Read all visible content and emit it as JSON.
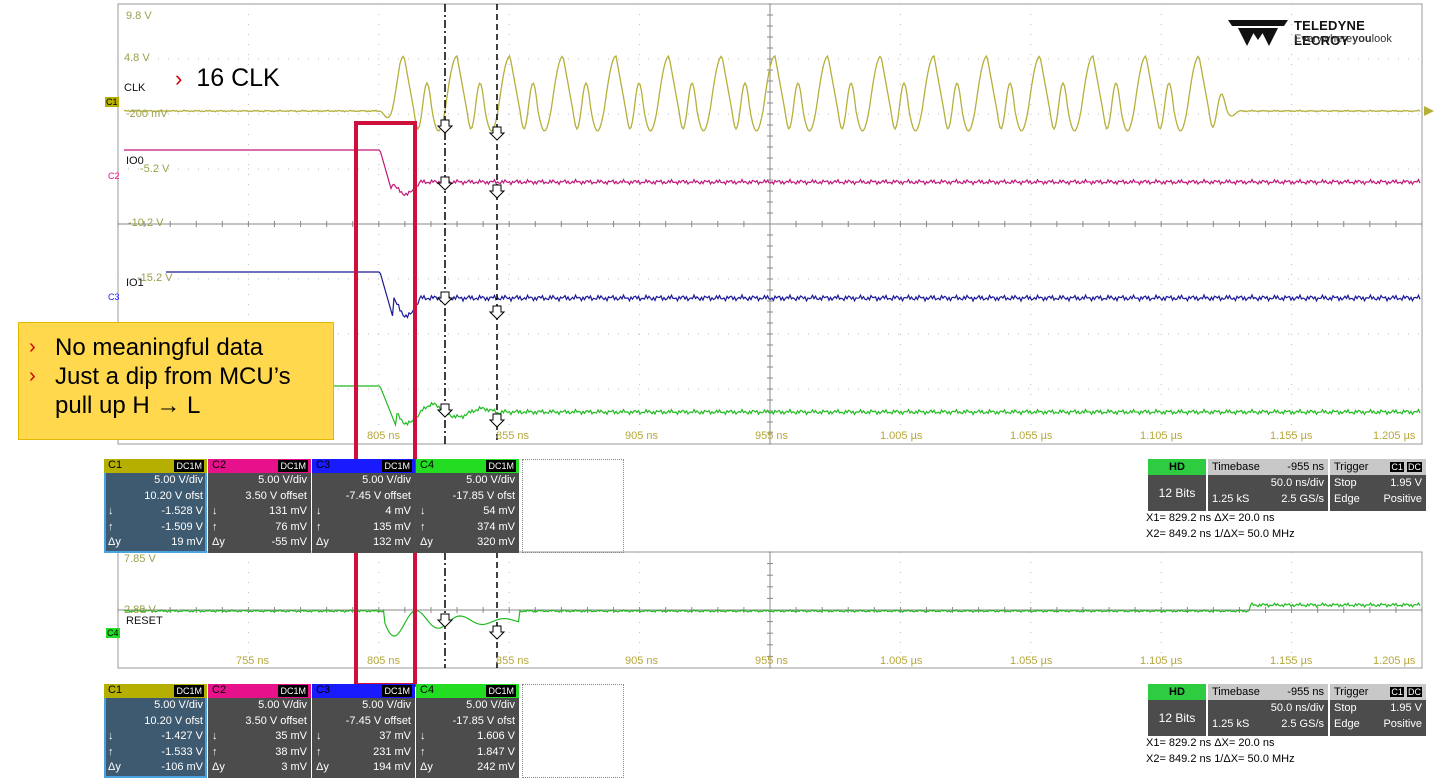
{
  "annotation": {
    "clk_note": "16 CLK",
    "chevron": "›"
  },
  "note": {
    "chevron": "›",
    "line1": "No meaningful data",
    "line2": "Just a dip from MCU’s pull up H → L"
  },
  "logo": {
    "brand": "TELEDYNE LECROY",
    "tagline_pre": "Everywhere",
    "tagline_bold": "you",
    "tagline_post": "look"
  },
  "top_grid": {
    "voltage_labels": [
      "9.8 V",
      "4.8 V",
      "-200 mV",
      "-5.2 V",
      "-10.2 V",
      "-15.2 V"
    ],
    "channel_labels": [
      "CLK",
      "IO0",
      "IO1"
    ],
    "channel_markers": [
      "C1",
      "C2",
      "C3"
    ],
    "time_ticks": [
      "805 ns",
      "855 ns",
      "905 ns",
      "955 ns",
      "1.005 µs",
      "1.055 µs",
      "1.105 µs",
      "1.155 µs",
      "1.205 µs"
    ]
  },
  "bottom_grid": {
    "voltage_labels": [
      "7.85 V",
      "2.85 V"
    ],
    "channel_labels": [
      "RESET"
    ],
    "channel_markers": [
      "C4"
    ],
    "time_ticks": [
      "755 ns",
      "805 ns",
      "855 ns",
      "905 ns",
      "955 ns",
      "1.005 µs",
      "1.055 µs",
      "1.105 µs",
      "1.155 µs",
      "1.205 µs"
    ]
  },
  "panel1": {
    "channels": [
      {
        "name": "C1",
        "coupling": "DC1M",
        "color": "#b5b000",
        "vdiv": "5.00 V/div",
        "offset": "10.20 V ofst",
        "min": "-1.528 V",
        "max": "-1.509 V",
        "dy": "19 mV"
      },
      {
        "name": "C2",
        "coupling": "DC1M",
        "color": "#e8118c",
        "vdiv": "5.00 V/div",
        "offset": "3.50 V offset",
        "min": "131 mV",
        "max": "76 mV",
        "dy": "-55 mV"
      },
      {
        "name": "C3",
        "coupling": "DC1M",
        "color": "#1a1aff",
        "vdiv": "5.00 V/div",
        "offset": "-7.45 V offset",
        "min": "4 mV",
        "max": "135 mV",
        "dy": "132 mV"
      },
      {
        "name": "C4",
        "coupling": "DC1M",
        "color": "#22dd22",
        "vdiv": "5.00 V/div",
        "offset": "-17.85 V ofst",
        "min": "54 mV",
        "max": "374 mV",
        "dy": "320 mV"
      }
    ]
  },
  "panel2": {
    "channels": [
      {
        "name": "C1",
        "coupling": "DC1M",
        "color": "#b5b000",
        "vdiv": "5.00 V/div",
        "offset": "10.20 V ofst",
        "min": "-1.427 V",
        "max": "-1.533 V",
        "dy": "-106 mV"
      },
      {
        "name": "C2",
        "coupling": "DC1M",
        "color": "#e8118c",
        "vdiv": "5.00 V/div",
        "offset": "3.50 V offset",
        "min": "35 mV",
        "max": "38 mV",
        "dy": "3 mV"
      },
      {
        "name": "C3",
        "coupling": "DC1M",
        "color": "#1a1aff",
        "vdiv": "5.00 V/div",
        "offset": "-7.45 V offset",
        "min": "37 mV",
        "max": "231 mV",
        "dy": "194 mV"
      },
      {
        "name": "C4",
        "coupling": "DC1M",
        "color": "#22dd22",
        "vdiv": "5.00 V/div",
        "offset": "-17.85 V ofst",
        "min": "1.606 V",
        "max": "1.847 V",
        "dy": "242 mV"
      }
    ]
  },
  "row_keys": {
    "min": "↓",
    "max": "↑",
    "dy": "Δy"
  },
  "timebase": {
    "hd": "HD",
    "bits": "12 Bits",
    "tb_label": "Timebase",
    "tb_value": "-955 ns",
    "ns_div": "50.0 ns/div",
    "samples": "1.25 kS",
    "rate": "2.5 GS/s",
    "trig_label": "Trigger",
    "trig_ch": "C1",
    "trig_cp": "DC",
    "trig_mode": "Stop",
    "trig_level": "1.95 V",
    "trig_type": "Edge",
    "trig_slope": "Positive",
    "x1": "X1= 829.2 ns ΔX=    20.0 ns",
    "x2": "X2= 849.2 ns 1/ΔX= 50.0 MHz"
  }
}
